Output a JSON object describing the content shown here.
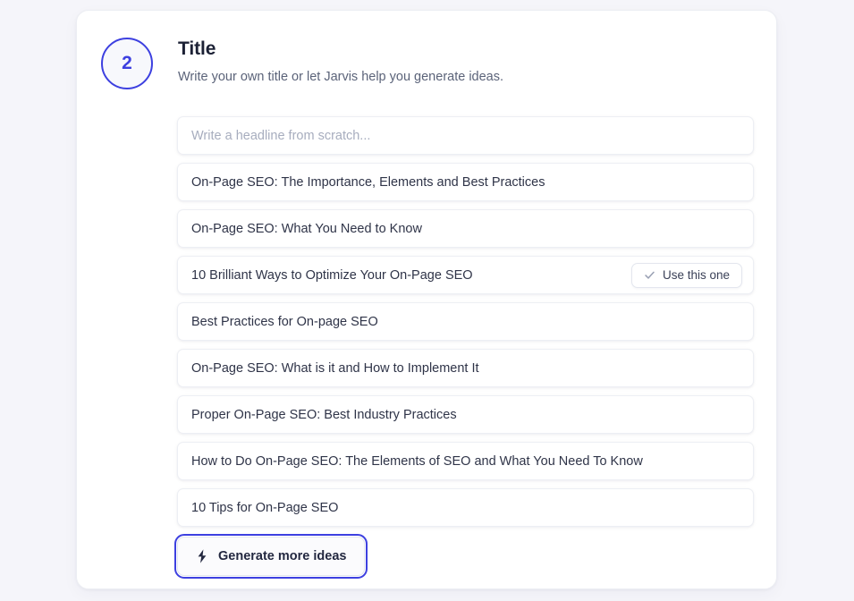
{
  "step": {
    "number": "2"
  },
  "header": {
    "title": "Title",
    "subtitle": "Write your own title or let Jarvis help you generate ideas."
  },
  "headline_input": {
    "value": "",
    "placeholder": "Write a headline from scratch..."
  },
  "suggestions": [
    {
      "text": "On-Page SEO: The Importance, Elements and Best Practices",
      "hovered": false
    },
    {
      "text": "On-Page SEO: What You Need to Know",
      "hovered": false
    },
    {
      "text": "10 Brilliant Ways to Optimize Your On-Page SEO",
      "hovered": true
    },
    {
      "text": "Best Practices for On-page SEO",
      "hovered": false
    },
    {
      "text": "On-Page SEO: What is it and How to Implement It",
      "hovered": false
    },
    {
      "text": "Proper On-Page SEO: Best Industry Practices",
      "hovered": false
    },
    {
      "text": "How to Do On-Page SEO: The Elements of SEO and What You Need To Know",
      "hovered": false
    },
    {
      "text": "10 Tips for On-Page SEO",
      "hovered": false
    }
  ],
  "use_this_one": {
    "label": "Use this one",
    "icon": "check-icon"
  },
  "generate_button": {
    "label": "Generate more ideas",
    "icon": "lightning-bolt-icon"
  },
  "colors": {
    "page_background": "#f5f5fa",
    "card_background": "#ffffff",
    "accent": "#3d40e0",
    "title_text": "#1c2135",
    "subtitle_text": "#5b6379",
    "row_text": "#2f3448",
    "placeholder_text": "#a7adbe",
    "row_border": "#edeff4"
  }
}
